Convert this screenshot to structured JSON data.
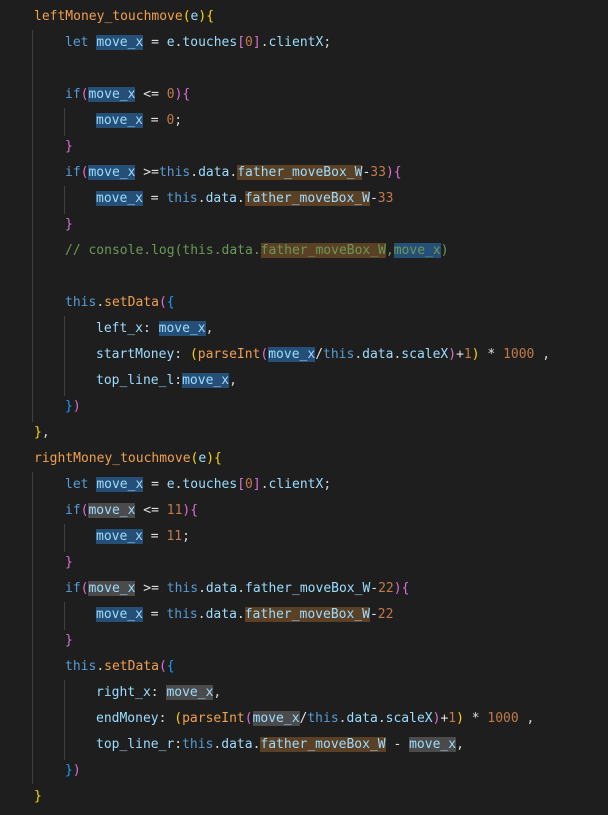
{
  "editor": {
    "lines": [
      {
        "indent": 1,
        "tokens": [
          {
            "t": "leftMoney_touchmove",
            "c": "fn"
          },
          {
            "t": "(",
            "c": "y"
          },
          {
            "t": "e",
            "c": "v"
          },
          {
            "t": ")",
            "c": "y"
          },
          {
            "t": "{",
            "c": "y"
          }
        ]
      },
      {
        "indent": 2,
        "tokens": [
          {
            "t": "let ",
            "c": "k"
          },
          {
            "t": "move_x",
            "c": "v",
            "h": "h1"
          },
          {
            "t": " = ",
            "c": "o"
          },
          {
            "t": "e",
            "c": "v"
          },
          {
            "t": ".",
            "c": "p"
          },
          {
            "t": "touches",
            "c": "v"
          },
          {
            "t": "[",
            "c": "pk"
          },
          {
            "t": "0",
            "c": "m"
          },
          {
            "t": "]",
            "c": "pk"
          },
          {
            "t": ".",
            "c": "p"
          },
          {
            "t": "clientX",
            "c": "v"
          },
          {
            "t": ";",
            "c": "p"
          }
        ]
      },
      {
        "indent": 2,
        "tokens": []
      },
      {
        "indent": 2,
        "tokens": [
          {
            "t": "if",
            "c": "k"
          },
          {
            "t": "(",
            "c": "pk"
          },
          {
            "t": "move_x",
            "c": "v",
            "h": "h1"
          },
          {
            "t": " <= ",
            "c": "o"
          },
          {
            "t": "0",
            "c": "m"
          },
          {
            "t": ")",
            "c": "pk"
          },
          {
            "t": "{",
            "c": "pk"
          }
        ]
      },
      {
        "indent": 3,
        "tokens": [
          {
            "t": "move_x",
            "c": "v",
            "h": "h1"
          },
          {
            "t": " = ",
            "c": "o"
          },
          {
            "t": "0",
            "c": "m"
          },
          {
            "t": ";",
            "c": "p"
          }
        ]
      },
      {
        "indent": 2,
        "tokens": [
          {
            "t": "}",
            "c": "pk"
          }
        ]
      },
      {
        "indent": 2,
        "tokens": [
          {
            "t": "if",
            "c": "k"
          },
          {
            "t": "(",
            "c": "pk"
          },
          {
            "t": "move_x",
            "c": "v",
            "h": "h1"
          },
          {
            "t": " >=",
            "c": "o"
          },
          {
            "t": "this",
            "c": "k"
          },
          {
            "t": ".",
            "c": "p"
          },
          {
            "t": "data",
            "c": "v"
          },
          {
            "t": ".",
            "c": "p"
          },
          {
            "t": "father_moveBox_W",
            "c": "v",
            "h": "h3"
          },
          {
            "t": "-",
            "c": "o"
          },
          {
            "t": "33",
            "c": "m"
          },
          {
            "t": ")",
            "c": "pk"
          },
          {
            "t": "{",
            "c": "pk"
          }
        ]
      },
      {
        "indent": 3,
        "tokens": [
          {
            "t": "move_x",
            "c": "v",
            "h": "h1"
          },
          {
            "t": " = ",
            "c": "o"
          },
          {
            "t": "this",
            "c": "k"
          },
          {
            "t": ".",
            "c": "p"
          },
          {
            "t": "data",
            "c": "v"
          },
          {
            "t": ".",
            "c": "p"
          },
          {
            "t": "father_moveBox_W",
            "c": "v",
            "h": "h3"
          },
          {
            "t": "-",
            "c": "o"
          },
          {
            "t": "33",
            "c": "m"
          }
        ]
      },
      {
        "indent": 2,
        "tokens": [
          {
            "t": "}",
            "c": "pk"
          }
        ]
      },
      {
        "indent": 2,
        "tokens": [
          {
            "t": "// console.log(this.data.",
            "c": "g"
          },
          {
            "t": "father_moveBox_W",
            "c": "g",
            "h": "h3"
          },
          {
            "t": ",",
            "c": "g"
          },
          {
            "t": "move_x",
            "c": "g",
            "h": "h1"
          },
          {
            "t": ")",
            "c": "g"
          }
        ]
      },
      {
        "indent": 2,
        "tokens": []
      },
      {
        "indent": 2,
        "tokens": [
          {
            "t": "this",
            "c": "k"
          },
          {
            "t": ".",
            "c": "p"
          },
          {
            "t": "setData",
            "c": "fn"
          },
          {
            "t": "(",
            "c": "pk"
          },
          {
            "t": "{",
            "c": "bl"
          }
        ]
      },
      {
        "indent": 3,
        "tokens": [
          {
            "t": "left_x",
            "c": "v"
          },
          {
            "t": ": ",
            "c": "p"
          },
          {
            "t": "move_x",
            "c": "v",
            "h": "h1"
          },
          {
            "t": ",",
            "c": "p"
          }
        ]
      },
      {
        "indent": 3,
        "tokens": [
          {
            "t": "startMoney",
            "c": "v"
          },
          {
            "t": ": ",
            "c": "p"
          },
          {
            "t": "(",
            "c": "y"
          },
          {
            "t": "parseInt",
            "c": "fn"
          },
          {
            "t": "(",
            "c": "pk"
          },
          {
            "t": "move_x",
            "c": "v",
            "h": "h1"
          },
          {
            "t": "/",
            "c": "o"
          },
          {
            "t": "this",
            "c": "k"
          },
          {
            "t": ".",
            "c": "p"
          },
          {
            "t": "data",
            "c": "v"
          },
          {
            "t": ".",
            "c": "p"
          },
          {
            "t": "scaleX",
            "c": "v"
          },
          {
            "t": ")",
            "c": "pk"
          },
          {
            "t": "+",
            "c": "o"
          },
          {
            "t": "1",
            "c": "m"
          },
          {
            "t": ")",
            "c": "y"
          },
          {
            "t": " * ",
            "c": "o"
          },
          {
            "t": "1000",
            "c": "m"
          },
          {
            "t": " ,",
            "c": "p"
          }
        ]
      },
      {
        "indent": 3,
        "tokens": [
          {
            "t": "top_line_l",
            "c": "v"
          },
          {
            "t": ":",
            "c": "p"
          },
          {
            "t": "move_x",
            "c": "v",
            "h": "h1"
          },
          {
            "t": ",",
            "c": "p"
          }
        ]
      },
      {
        "indent": 2,
        "tokens": [
          {
            "t": "}",
            "c": "bl"
          },
          {
            "t": ")",
            "c": "pk"
          }
        ]
      },
      {
        "indent": 1,
        "tokens": [
          {
            "t": "}",
            "c": "y"
          },
          {
            "t": ",",
            "c": "p"
          }
        ]
      },
      {
        "indent": 1,
        "tokens": [
          {
            "t": "rightMoney_touchmove",
            "c": "fn"
          },
          {
            "t": "(",
            "c": "y"
          },
          {
            "t": "e",
            "c": "v"
          },
          {
            "t": ")",
            "c": "y"
          },
          {
            "t": "{",
            "c": "y"
          }
        ]
      },
      {
        "indent": 2,
        "tokens": [
          {
            "t": "let ",
            "c": "k"
          },
          {
            "t": "move_x",
            "c": "v",
            "h": "h1"
          },
          {
            "t": " = ",
            "c": "o"
          },
          {
            "t": "e",
            "c": "v"
          },
          {
            "t": ".",
            "c": "p"
          },
          {
            "t": "touches",
            "c": "v"
          },
          {
            "t": "[",
            "c": "pk"
          },
          {
            "t": "0",
            "c": "m"
          },
          {
            "t": "]",
            "c": "pk"
          },
          {
            "t": ".",
            "c": "p"
          },
          {
            "t": "clientX",
            "c": "v"
          },
          {
            "t": ";",
            "c": "p"
          }
        ]
      },
      {
        "indent": 2,
        "tokens": [
          {
            "t": "if",
            "c": "k"
          },
          {
            "t": "(",
            "c": "pk"
          },
          {
            "t": "move_x",
            "c": "v",
            "h": "h2"
          },
          {
            "t": " <= ",
            "c": "o"
          },
          {
            "t": "11",
            "c": "m"
          },
          {
            "t": ")",
            "c": "pk"
          },
          {
            "t": "{",
            "c": "pk"
          }
        ]
      },
      {
        "indent": 3,
        "tokens": [
          {
            "t": "move_x",
            "c": "v",
            "h": "h1"
          },
          {
            "t": " = ",
            "c": "o"
          },
          {
            "t": "11",
            "c": "m"
          },
          {
            "t": ";",
            "c": "p"
          }
        ]
      },
      {
        "indent": 2,
        "tokens": [
          {
            "t": "}",
            "c": "pk"
          }
        ]
      },
      {
        "indent": 2,
        "tokens": [
          {
            "t": "if",
            "c": "k"
          },
          {
            "t": "(",
            "c": "pk"
          },
          {
            "t": "move_x",
            "c": "v",
            "h": "h2"
          },
          {
            "t": " >= ",
            "c": "o"
          },
          {
            "t": "this",
            "c": "k"
          },
          {
            "t": ".",
            "c": "p"
          },
          {
            "t": "data",
            "c": "v"
          },
          {
            "t": ".",
            "c": "p"
          },
          {
            "t": "father_moveBox_W",
            "c": "v"
          },
          {
            "t": "-",
            "c": "o"
          },
          {
            "t": "22",
            "c": "m"
          },
          {
            "t": ")",
            "c": "pk"
          },
          {
            "t": "{",
            "c": "pk"
          }
        ]
      },
      {
        "indent": 3,
        "tokens": [
          {
            "t": "move_x",
            "c": "v",
            "h": "h1"
          },
          {
            "t": " = ",
            "c": "o"
          },
          {
            "t": "this",
            "c": "k"
          },
          {
            "t": ".",
            "c": "p"
          },
          {
            "t": "data",
            "c": "v"
          },
          {
            "t": ".",
            "c": "p"
          },
          {
            "t": "father_moveBox_W",
            "c": "v",
            "h": "h3"
          },
          {
            "t": "-",
            "c": "o"
          },
          {
            "t": "22",
            "c": "m"
          }
        ]
      },
      {
        "indent": 2,
        "tokens": [
          {
            "t": "}",
            "c": "pk"
          }
        ]
      },
      {
        "indent": 2,
        "tokens": [
          {
            "t": "this",
            "c": "k"
          },
          {
            "t": ".",
            "c": "p"
          },
          {
            "t": "setData",
            "c": "fn"
          },
          {
            "t": "(",
            "c": "pk"
          },
          {
            "t": "{",
            "c": "bl"
          }
        ]
      },
      {
        "indent": 3,
        "tokens": [
          {
            "t": "right_x",
            "c": "v"
          },
          {
            "t": ": ",
            "c": "p"
          },
          {
            "t": "move_x",
            "c": "v",
            "h": "h2"
          },
          {
            "t": ",",
            "c": "p"
          }
        ]
      },
      {
        "indent": 3,
        "tokens": [
          {
            "t": "endMoney",
            "c": "v"
          },
          {
            "t": ": ",
            "c": "p"
          },
          {
            "t": "(",
            "c": "y"
          },
          {
            "t": "parseInt",
            "c": "fn"
          },
          {
            "t": "(",
            "c": "pk"
          },
          {
            "t": "move_x",
            "c": "v",
            "h": "h2"
          },
          {
            "t": "/",
            "c": "o"
          },
          {
            "t": "this",
            "c": "k"
          },
          {
            "t": ".",
            "c": "p"
          },
          {
            "t": "data",
            "c": "v"
          },
          {
            "t": ".",
            "c": "p"
          },
          {
            "t": "scaleX",
            "c": "v"
          },
          {
            "t": ")",
            "c": "pk"
          },
          {
            "t": "+",
            "c": "o"
          },
          {
            "t": "1",
            "c": "m"
          },
          {
            "t": ")",
            "c": "y"
          },
          {
            "t": " * ",
            "c": "o"
          },
          {
            "t": "1000",
            "c": "m"
          },
          {
            "t": " ,",
            "c": "p"
          }
        ]
      },
      {
        "indent": 3,
        "tokens": [
          {
            "t": "top_line_r",
            "c": "v"
          },
          {
            "t": ":",
            "c": "p"
          },
          {
            "t": "this",
            "c": "k"
          },
          {
            "t": ".",
            "c": "p"
          },
          {
            "t": "data",
            "c": "v"
          },
          {
            "t": ".",
            "c": "p"
          },
          {
            "t": "father_moveBox_W",
            "c": "v",
            "h": "h3"
          },
          {
            "t": " - ",
            "c": "o"
          },
          {
            "t": "move_x",
            "c": "v",
            "h": "h2"
          },
          {
            "t": ",",
            "c": "p"
          }
        ]
      },
      {
        "indent": 2,
        "tokens": [
          {
            "t": "}",
            "c": "bl"
          },
          {
            "t": ")",
            "c": "pk"
          }
        ]
      },
      {
        "indent": 1,
        "tokens": [
          {
            "t": "}",
            "c": "y"
          }
        ]
      }
    ]
  }
}
